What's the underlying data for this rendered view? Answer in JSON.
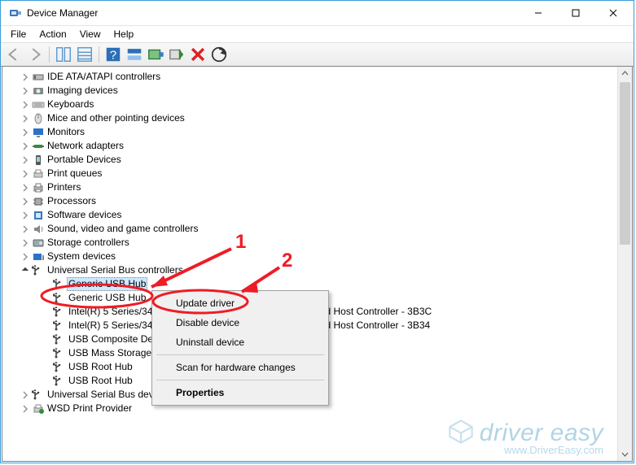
{
  "window": {
    "title": "Device Manager",
    "min_tip": "Minimize",
    "max_tip": "Maximize",
    "close_tip": "Close"
  },
  "menu": {
    "file": "File",
    "action": "Action",
    "view": "View",
    "help": "Help"
  },
  "toolbar_names": [
    "back",
    "forward",
    "show-hide-tree",
    "properties",
    "help",
    "update-driver",
    "enable",
    "uninstall",
    "scan-hardware",
    "show-hidden"
  ],
  "tree": {
    "items": [
      {
        "icon": "ide",
        "label": "IDE ATA/ATAPI controllers"
      },
      {
        "icon": "imaging",
        "label": "Imaging devices"
      },
      {
        "icon": "keyboard",
        "label": "Keyboards"
      },
      {
        "icon": "mouse",
        "label": "Mice and other pointing devices"
      },
      {
        "icon": "monitor",
        "label": "Monitors"
      },
      {
        "icon": "network",
        "label": "Network adapters"
      },
      {
        "icon": "portable",
        "label": "Portable Devices"
      },
      {
        "icon": "printq",
        "label": "Print queues"
      },
      {
        "icon": "printer",
        "label": "Printers"
      },
      {
        "icon": "cpu",
        "label": "Processors"
      },
      {
        "icon": "software",
        "label": "Software devices"
      },
      {
        "icon": "sound",
        "label": "Sound, video and game controllers"
      },
      {
        "icon": "storage",
        "label": "Storage controllers"
      },
      {
        "icon": "system",
        "label": "System devices"
      }
    ],
    "usb_cat": {
      "label": "Universal Serial Bus controllers"
    },
    "usb_children": [
      {
        "label": "Generic USB Hub"
      },
      {
        "label": "Generic USB Hub"
      },
      {
        "label": "Intel(R) 5 Series/3400 Series Chipset Family USB Enhanced Host Controller - 3B3C"
      },
      {
        "label": "Intel(R) 5 Series/3400 Series Chipset Family USB Enhanced Host Controller - 3B34"
      },
      {
        "label": "USB Composite Device"
      },
      {
        "label": "USB Mass Storage Device"
      },
      {
        "label": "USB Root Hub"
      },
      {
        "label": "USB Root Hub"
      }
    ],
    "after": [
      {
        "icon": "usb",
        "label": "Universal Serial Bus devices"
      },
      {
        "icon": "wsd",
        "label": "WSD Print Provider"
      }
    ]
  },
  "ctx": {
    "update": "Update driver",
    "disable": "Disable device",
    "uninstall": "Uninstall device",
    "scan": "Scan for hardware changes",
    "props": "Properties"
  },
  "annotations": {
    "n1": "1",
    "n2": "2"
  },
  "watermark": {
    "brand": "driver easy",
    "url": "www.DriverEasy.com"
  }
}
